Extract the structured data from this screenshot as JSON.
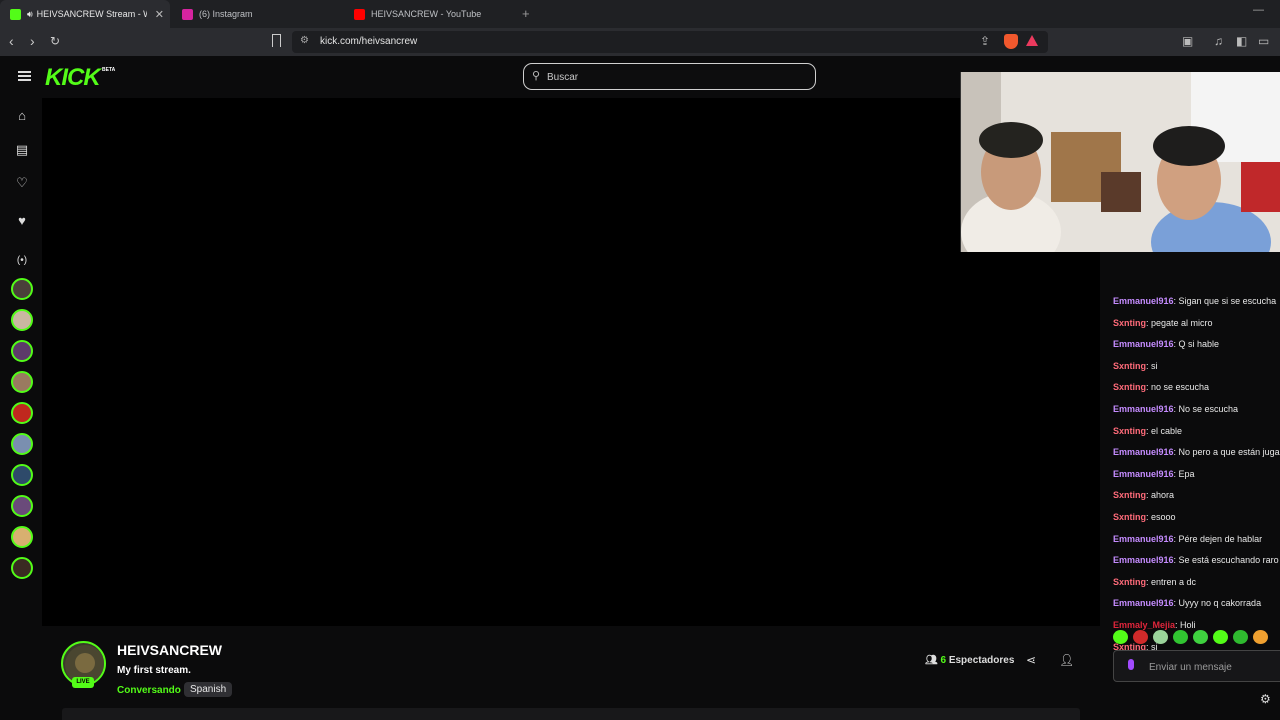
{
  "browser": {
    "tabs": [
      {
        "title": "HEIVSANCREW Stream - Wat",
        "favicon_color": "#53fc18"
      },
      {
        "title": "(6) Instagram",
        "favicon_color": "#d6249f"
      },
      {
        "title": "HEIVSANCREW - YouTube",
        "favicon_color": "#ff0000"
      }
    ],
    "url": "kick.com/heivsancrew"
  },
  "kick": {
    "logo": "KICK",
    "logo_badge": "BETA",
    "search_placeholder": "Buscar",
    "accent_color": "#53fc18"
  },
  "stream": {
    "channel_name": "HEIVSANCREW",
    "live_badge": "LIVE",
    "title": "My first stream.",
    "category": "Conversando",
    "language": "Spanish",
    "viewers_count": "6",
    "viewers_label": "Espectadores"
  },
  "chat": {
    "messages": [
      {
        "user": "Emmanuel916",
        "text": ": Sigan que si se escucha",
        "color": "#c58cff"
      },
      {
        "user": "Sxnting",
        "text": ": pegate al micro",
        "color": "#ff6b7a"
      },
      {
        "user": "Emmanuel916",
        "text": ": Q si hable",
        "color": "#c58cff"
      },
      {
        "user": "Sxnting",
        "text": ": si",
        "color": "#ff6b7a"
      },
      {
        "user": "Sxnting",
        "text": ": no se escucha",
        "color": "#ff6b7a"
      },
      {
        "user": "Emmanuel916",
        "text": ": No se escucha",
        "color": "#c58cff"
      },
      {
        "user": "Sxnting",
        "text": ": el cable",
        "color": "#ff6b7a"
      },
      {
        "user": "Emmanuel916",
        "text": ": No pero a que están jugando",
        "color": "#c58cff"
      },
      {
        "user": "Emmanuel916",
        "text": ": Epa",
        "color": "#c58cff"
      },
      {
        "user": "Sxnting",
        "text": ": ahora",
        "color": "#ff6b7a"
      },
      {
        "user": "Sxnting",
        "text": ": esooo",
        "color": "#ff6b7a"
      },
      {
        "user": "Emmanuel916",
        "text": ": Pére dejen de hablar",
        "color": "#c58cff"
      },
      {
        "user": "Emmanuel916",
        "text": ": Se está escuchando raro",
        "color": "#c58cff"
      },
      {
        "user": "Sxnting",
        "text": ": entren a dc",
        "color": "#ff6b7a"
      },
      {
        "user": "Emmanuel916",
        "text": ": Uyyy no q cakorrada",
        "color": "#c58cff"
      },
      {
        "user": "Emmaly_Mejia",
        "text": ": Holi",
        "color": "#e0253b"
      },
      {
        "user": "Sxnting",
        "text": ": si",
        "color": "#ff6b7a"
      }
    ],
    "input_placeholder": "Enviar un mensaje"
  },
  "sidebar": {
    "icons": [
      "home-icon",
      "browse-icon",
      "following-icon",
      "favorite-icon",
      "live-icon"
    ],
    "avatar_count": 10
  }
}
